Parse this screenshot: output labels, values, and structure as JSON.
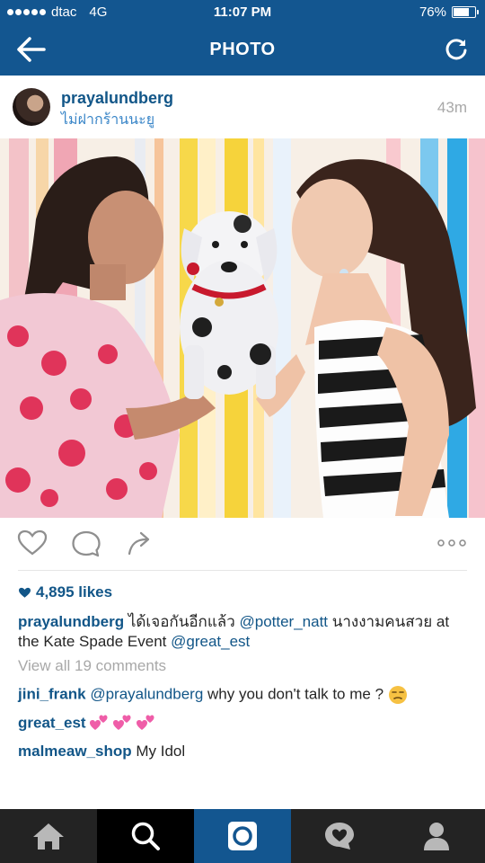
{
  "status_bar": {
    "carrier": "dtac",
    "network": "4G",
    "time": "11:07 PM",
    "battery_text": "76%",
    "battery_level": 0.76
  },
  "nav": {
    "title": "PHOTO",
    "back_icon": "arrow-left-icon",
    "refresh_icon": "refresh-icon"
  },
  "post": {
    "username": "prayalundberg",
    "location": "ไม่ฝากร้านนะยู",
    "age": "43m"
  },
  "likes": {
    "count_text": "4,895 likes"
  },
  "caption": {
    "username": "prayalundberg",
    "part1": "ได้เจอกันอีกแล้ว",
    "mention1": "@potter_natt",
    "part2": "นางงามคนสวย at the Kate Spade Event",
    "mention2": "@great_est"
  },
  "view_all_comments": "View all 19 comments",
  "comments": [
    {
      "username": "jini_frank",
      "mention": "@prayalundberg",
      "text": "why you don't talk to me ?"
    },
    {
      "username": "great_est",
      "text": ""
    },
    {
      "username": "malmeaw_shop",
      "text": "My Idol"
    }
  ],
  "colors": {
    "brand_blue": "#135690",
    "link_blue": "#125688",
    "muted_gray": "#a8a8a8",
    "tabbar_bg": "#232323"
  },
  "tabs": [
    {
      "name": "home",
      "icon": "home-icon"
    },
    {
      "name": "search",
      "icon": "search-icon",
      "active": true
    },
    {
      "name": "camera",
      "icon": "camera-icon"
    },
    {
      "name": "activity",
      "icon": "heart-bubble-icon"
    },
    {
      "name": "profile",
      "icon": "profile-icon"
    }
  ]
}
